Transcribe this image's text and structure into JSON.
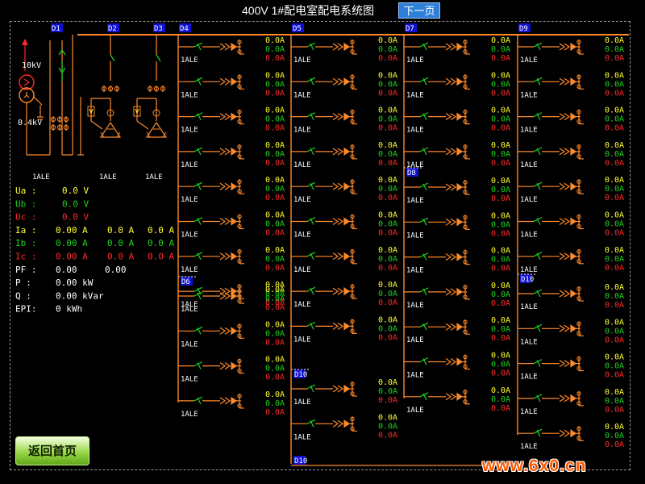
{
  "header": {
    "title": "400V 1#配电室配电系统图",
    "next_label": "下一页"
  },
  "footer": {
    "home_label": "返回首页",
    "watermark": "www.6x0.cn"
  },
  "colors": {
    "orange": "#ff8a2a",
    "green": "#1fd41f",
    "yellow": "#ffff33",
    "red": "#ff2a2a",
    "white": "#ffffff",
    "blue": "#1010d0"
  },
  "incoming": {
    "hv_label": "10kV",
    "lv_label": "0.4kV",
    "bus_labels": [
      "D1",
      "D2",
      "D3",
      "D4"
    ],
    "unit_labels": [
      "1ALE",
      "1ALE",
      "1ALE"
    ]
  },
  "meter": {
    "rows": [
      {
        "key": "voltage_a",
        "label": "Ua :",
        "color": "yellow",
        "values": [
          "0.0 V"
        ]
      },
      {
        "key": "voltage_b",
        "label": "Ub :",
        "color": "green",
        "values": [
          "0.0 V"
        ]
      },
      {
        "key": "voltage_c",
        "label": "Uc :",
        "color": "red",
        "values": [
          "0.0 V"
        ]
      },
      {
        "key": "current_a",
        "label": "Ia :",
        "color": "yellow",
        "values": [
          "0.00 A",
          "0.0 A",
          "0.0 A"
        ]
      },
      {
        "key": "current_b",
        "label": "Ib :",
        "color": "green",
        "values": [
          "0.00 A",
          "0.0 A",
          "0.0 A"
        ]
      },
      {
        "key": "current_c",
        "label": "Ic :",
        "color": "red",
        "values": [
          "0.00 A",
          "0.0 A",
          "0.0 A"
        ]
      },
      {
        "key": "power_factor",
        "label": "PF :",
        "color": "white",
        "values": [
          "0.00",
          "0.00"
        ]
      },
      {
        "key": "active_power",
        "label": "P  :",
        "color": "white",
        "values": [
          "0.00 kW"
        ]
      },
      {
        "key": "reactive_power",
        "label": "Q  :",
        "color": "white",
        "values": [
          "0.00 kVar"
        ]
      },
      {
        "key": "energy",
        "label": "EPI:",
        "color": "white",
        "values": [
          "0 kWh"
        ]
      }
    ]
  },
  "feeder_reading": [
    "0.0A",
    "0.0A",
    "0.0A"
  ],
  "feeder_label": "1ALE",
  "columns": [
    {
      "id": "c1",
      "blocks": [
        {
          "label": "D4",
          "count": 8
        },
        {
          "label": "D6",
          "count": 4
        }
      ]
    },
    {
      "id": "c2",
      "blocks": [
        {
          "label": "D5",
          "count": 9
        },
        {
          "label": "D10",
          "count": 2,
          "footer": true
        }
      ]
    },
    {
      "id": "c3",
      "blocks": [
        {
          "label": "D7",
          "count": 4
        },
        {
          "label": "D8",
          "count": 7
        }
      ]
    },
    {
      "id": "c4",
      "blocks": [
        {
          "label": "D9",
          "count": 7
        },
        {
          "label": "D10",
          "count": 5
        }
      ]
    }
  ]
}
